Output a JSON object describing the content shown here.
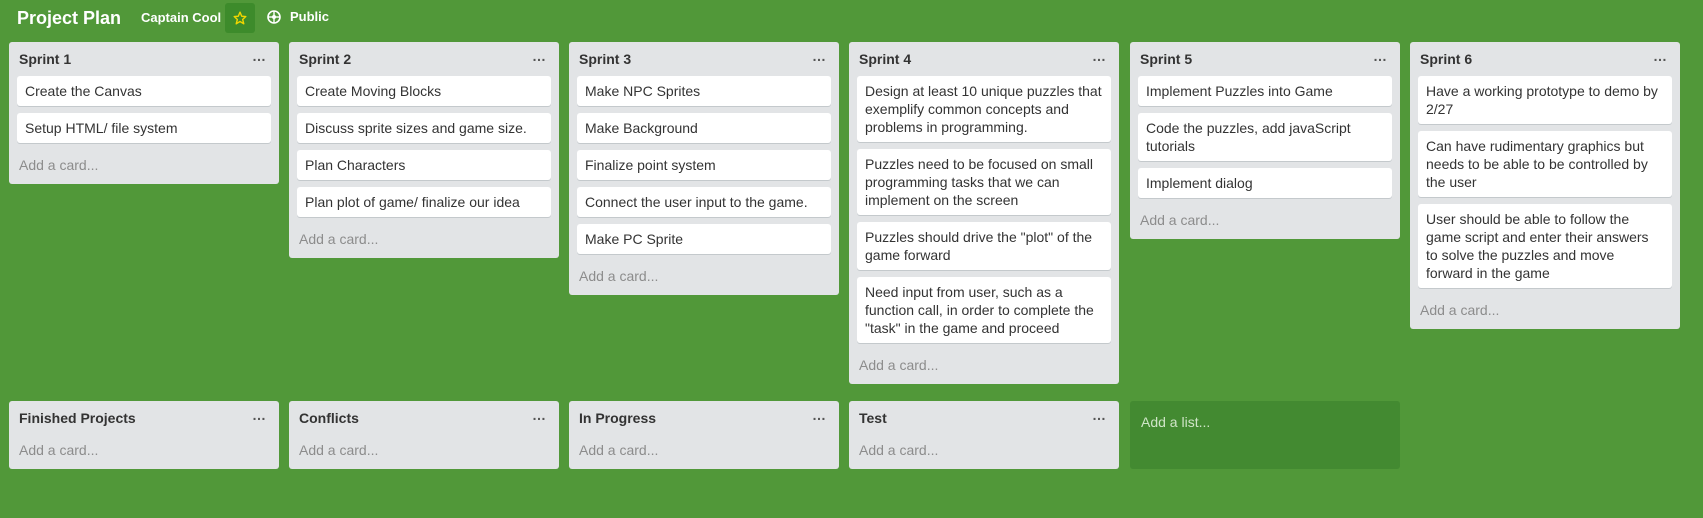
{
  "header": {
    "title": "Project Plan",
    "team": "Captain Cool",
    "visibility": "Public"
  },
  "lists": [
    {
      "title": "Sprint 1",
      "cards": [
        "Create the Canvas",
        "Setup HTML/ file system"
      ],
      "add_card": "Add a card..."
    },
    {
      "title": "Sprint 2",
      "cards": [
        "Create Moving Blocks",
        "Discuss sprite sizes and game size.",
        "Plan Characters",
        "Plan plot of game/ finalize our idea"
      ],
      "add_card": "Add a card..."
    },
    {
      "title": "Sprint 3",
      "cards": [
        "Make NPC Sprites",
        "Make Background",
        "Finalize point system",
        "Connect the user input to the game.",
        "Make PC Sprite"
      ],
      "add_card": "Add a card..."
    },
    {
      "title": "Sprint 4",
      "cards": [
        "Design at least 10 unique puzzles that exemplify common concepts and problems in programming.",
        "Puzzles need to be focused on small programming tasks that we can implement on the screen",
        "Puzzles should drive the \"plot\" of the game forward",
        "Need input from user, such as a function call, in order to complete the \"task\" in the game and proceed"
      ],
      "add_card": "Add a card..."
    },
    {
      "title": "Sprint 5",
      "cards": [
        "Implement Puzzles into Game",
        "Code the puzzles, add javaScript tutorials",
        "Implement dialog"
      ],
      "add_card": "Add a card..."
    },
    {
      "title": "Sprint 6",
      "cards": [
        "Have a working prototype to demo by 2/27",
        "Can have rudimentary graphics but needs to be able to be controlled by the user",
        "User should be able to follow the game script and enter their answers to solve the puzzles and move forward in the game"
      ],
      "add_card": "Add a card..."
    },
    {
      "title": "Finished Projects",
      "cards": [],
      "add_card": "Add a card..."
    },
    {
      "title": "Conflicts",
      "cards": [],
      "add_card": "Add a card..."
    },
    {
      "title": "In Progress",
      "cards": [],
      "add_card": "Add a card..."
    },
    {
      "title": "Test",
      "cards": [],
      "add_card": "Add a card..."
    }
  ],
  "add_list_label": "Add a list...",
  "icons": {
    "star": "star-icon",
    "visibility": "globe-icon",
    "list_menu": "ellipsis-icon"
  },
  "colors": {
    "board_background": "#519839",
    "star": "#f2d600",
    "list_background": "#e2e4e6"
  }
}
